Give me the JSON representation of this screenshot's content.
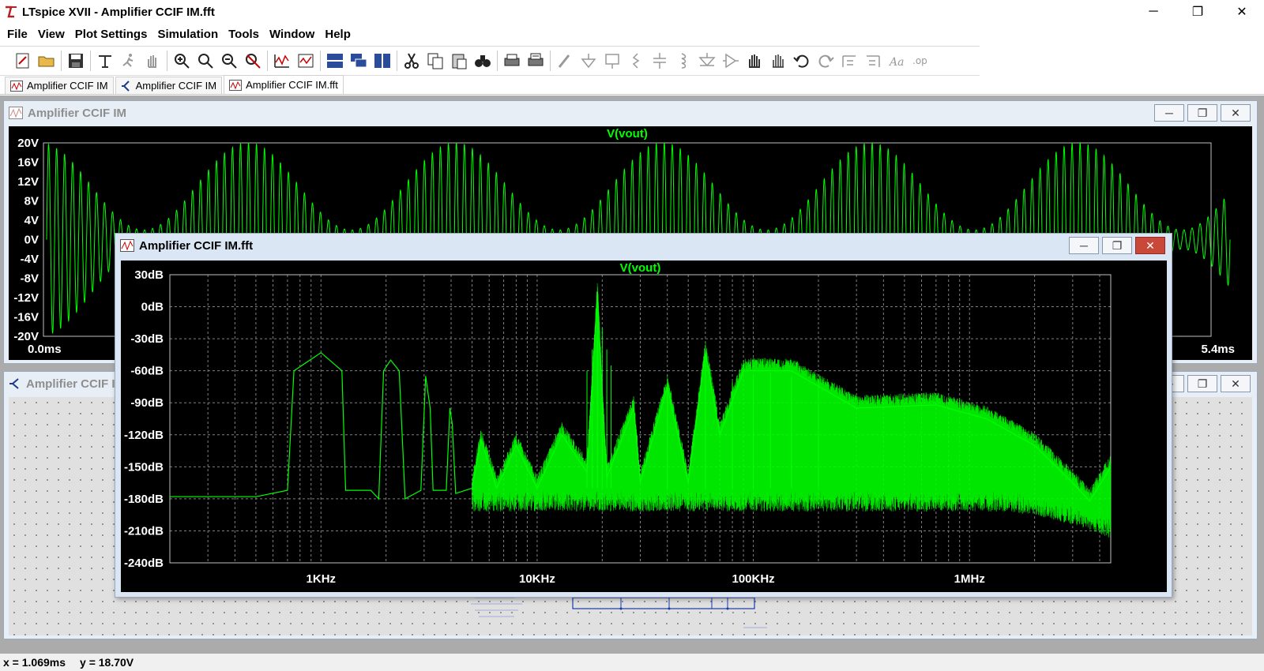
{
  "window": {
    "title": "LTspice XVII - Amplifier CCIF IM.fft",
    "minimize": "─",
    "maximize": "❐",
    "close": "✕"
  },
  "menu": [
    "File",
    "View",
    "Plot Settings",
    "Simulation",
    "Tools",
    "Window",
    "Help"
  ],
  "toolbar": {
    "icons": [
      "new-schematic-icon",
      "open-icon",
      "save-icon",
      "control-panel-icon",
      "run-icon",
      "pan-icon",
      "zoom-in-icon",
      "zoom-fit-icon",
      "zoom-out-icon",
      "zoom-cancel-icon",
      "autorange-icon",
      "plot-settings-icon",
      "tile-horizontal-icon",
      "cascade-icon",
      "tile-vertical-icon",
      "cut-icon",
      "copy-icon",
      "paste-icon",
      "find-icon",
      "print-icon",
      "print-preview-icon",
      "wire-icon",
      "ground-icon",
      "label-icon",
      "resistor-icon",
      "capacitor-icon",
      "inductor-icon",
      "diode-icon",
      "component-icon",
      "move-icon",
      "drag-icon",
      "undo-icon",
      "redo-icon",
      "rotate-icon",
      "mirror-icon",
      "text-icon",
      "spice-directive-icon"
    ]
  },
  "tabs": [
    {
      "label": "Amplifier CCIF IM",
      "icon": "waveform-icon",
      "active": false
    },
    {
      "label": "Amplifier CCIF IM",
      "icon": "schematic-icon",
      "active": false
    },
    {
      "label": "Amplifier CCIF IM.fft",
      "icon": "waveform-icon",
      "active": true
    }
  ],
  "time_window": {
    "title": "Amplifier CCIF IM",
    "trace": "V(vout)",
    "x_start": "0.0ms",
    "x_end": "5.4ms"
  },
  "schematic_window": {
    "title": "Amplifier CCIF I"
  },
  "fft_window": {
    "title": "Amplifier CCIF IM.fft",
    "trace": "V(vout)"
  },
  "colors": {
    "trace": "#00ff00",
    "plot_bg": "#000000",
    "grid": "#808080",
    "axis_text": "#ffffff"
  },
  "chart_data": [
    {
      "type": "line",
      "title": "V(vout)",
      "x_unit": "ms",
      "xlim": [
        0,
        5.4
      ],
      "ylim": [
        -20,
        20
      ],
      "y_ticks": [
        "20V",
        "16V",
        "12V",
        "8V",
        "4V",
        "0V",
        "-4V",
        "-8V",
        "-12V",
        "-16V",
        "-20V"
      ],
      "x_ticks": [
        "0.0ms",
        "5.4ms"
      ],
      "series": [
        {
          "name": "V(vout)",
          "amplitude_peak": 20,
          "carrier_cycles_visible": 148,
          "envelope_cycles_visible": 5.7
        }
      ]
    },
    {
      "type": "line",
      "title": "V(vout)",
      "x_scale": "log",
      "x_unit": "Hz",
      "xlim": [
        200,
        4500000
      ],
      "ylim": [
        -240,
        30
      ],
      "y_ticks": [
        "30dB",
        "0dB",
        "-30dB",
        "-60dB",
        "-90dB",
        "-120dB",
        "-150dB",
        "-180dB",
        "-210dB",
        "-240dB"
      ],
      "x_ticks": [
        "1KHz",
        "10KHz",
        "100KHz",
        "1MHz"
      ],
      "series": [
        {
          "name": "V(vout)",
          "points": [
            [
              200,
              -178
            ],
            [
              500,
              -178
            ],
            [
              700,
              -172
            ],
            [
              750,
              -60
            ],
            [
              1000,
              -43
            ],
            [
              1250,
              -60
            ],
            [
              1300,
              -172
            ],
            [
              1700,
              -172
            ],
            [
              1850,
              -180
            ],
            [
              1950,
              -60
            ],
            [
              2100,
              -50
            ],
            [
              2300,
              -60
            ],
            [
              2450,
              -180
            ],
            [
              2900,
              -172
            ],
            [
              3050,
              -65
            ],
            [
              3200,
              -95
            ],
            [
              3300,
              -172
            ],
            [
              3800,
              -172
            ],
            [
              3950,
              -95
            ],
            [
              4050,
              -110
            ],
            [
              4200,
              -175
            ],
            [
              5000,
              -170
            ],
            [
              5500,
              -125
            ],
            [
              6500,
              -170
            ],
            [
              8000,
              -130
            ],
            [
              10000,
              -170
            ],
            [
              13000,
              -120
            ],
            [
              17000,
              -155
            ],
            [
              19000,
              14
            ],
            [
              20000,
              -80
            ],
            [
              21000,
              -160
            ],
            [
              28000,
              -95
            ],
            [
              30000,
              -165
            ],
            [
              40000,
              -75
            ],
            [
              50000,
              -165
            ],
            [
              60000,
              -43
            ],
            [
              70000,
              -120
            ],
            [
              90000,
              -60
            ],
            [
              150000,
              -60
            ],
            [
              300000,
              -95
            ],
            [
              700000,
              -92
            ],
            [
              1200000,
              -105
            ],
            [
              2000000,
              -130
            ],
            [
              3000000,
              -165
            ],
            [
              3600000,
              -182
            ],
            [
              4200000,
              -160
            ],
            [
              4500000,
              -150
            ]
          ]
        }
      ]
    }
  ],
  "status": {
    "x": "x = 1.069ms",
    "y": "y = 18.70V"
  }
}
